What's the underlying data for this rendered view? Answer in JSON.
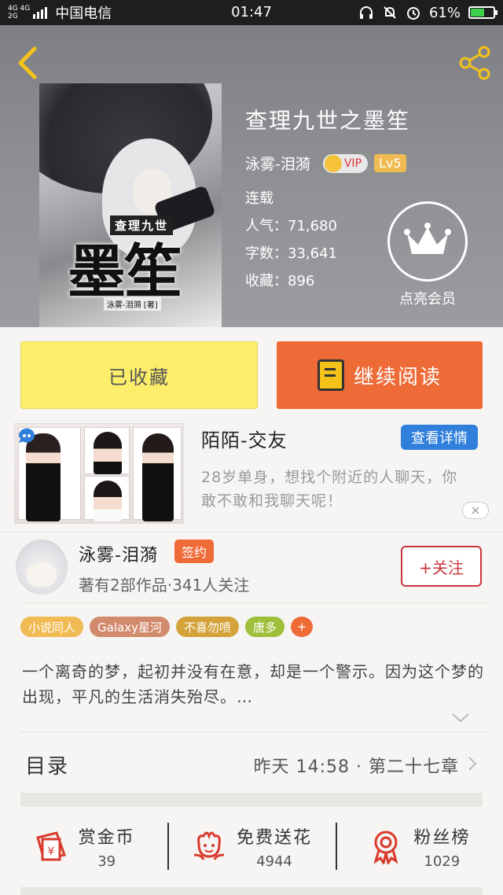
{
  "status_bar": {
    "network_top": "4G 4G",
    "network_bottom": "2G",
    "carrier": "中国电信",
    "time": "01:47",
    "battery_percent": "61%",
    "battery_level": 0.61
  },
  "header": {
    "icons": {
      "back": "chevron-left-icon",
      "share": "share-icon"
    },
    "cover": {
      "subtitle_text": "查理九世",
      "title_text": "墨笙",
      "author_text": "泳雾-泪漪 [著]"
    },
    "book": {
      "title": "查理九世之墨笙",
      "author": "泳雾-泪漪",
      "vip_label": "VIP",
      "level_label": "Lv5",
      "status": "连载",
      "popularity": "人气：71,680",
      "word_count": "字数：33,641",
      "favorites": "收藏：896"
    },
    "member": {
      "label": "点亮会员",
      "icon": "crown-icon"
    }
  },
  "actions": {
    "collect_label": "已收藏",
    "read_label": "继续阅读",
    "read_icon": "book-icon",
    "collect_color": "#fcee6b",
    "read_color": "#ee6a37"
  },
  "ad": {
    "title": "陌陌-交友",
    "detail_button": "查看详情",
    "description": "28岁单身，想找个附近的人聊天，你敢不敢和我聊天呢！",
    "close_icon": "close-icon",
    "brand_color": "#2f7fdb"
  },
  "author": {
    "name": "泳雾-泪漪",
    "badge": "签约",
    "stats": "著有2部作品·341人关注",
    "follow_label": "+关注"
  },
  "tags": [
    {
      "label": "小说同人",
      "color": "#f0bb53"
    },
    {
      "label": "Galaxy星河",
      "color": "#d28a6c"
    },
    {
      "label": "不喜勿喷",
      "color": "#d4a23a"
    },
    {
      "label": "唐多",
      "color": "#9fbf3b"
    }
  ],
  "tags_more": "+",
  "synopsis": "一个离奇的梦，起初并没有在意，却是一个警示。因为这个梦的出现，平凡的生活消失殆尽。…",
  "toc": {
    "label": "目录",
    "latest": "昨天 14:58 · 第二十七章"
  },
  "bottom": [
    {
      "label": "赏金币",
      "value": "39",
      "icon": "reward-envelope-icon"
    },
    {
      "label": "免费送花",
      "value": "4944",
      "icon": "flower-icon"
    },
    {
      "label": "粉丝榜",
      "value": "1029",
      "icon": "medal-icon"
    }
  ]
}
